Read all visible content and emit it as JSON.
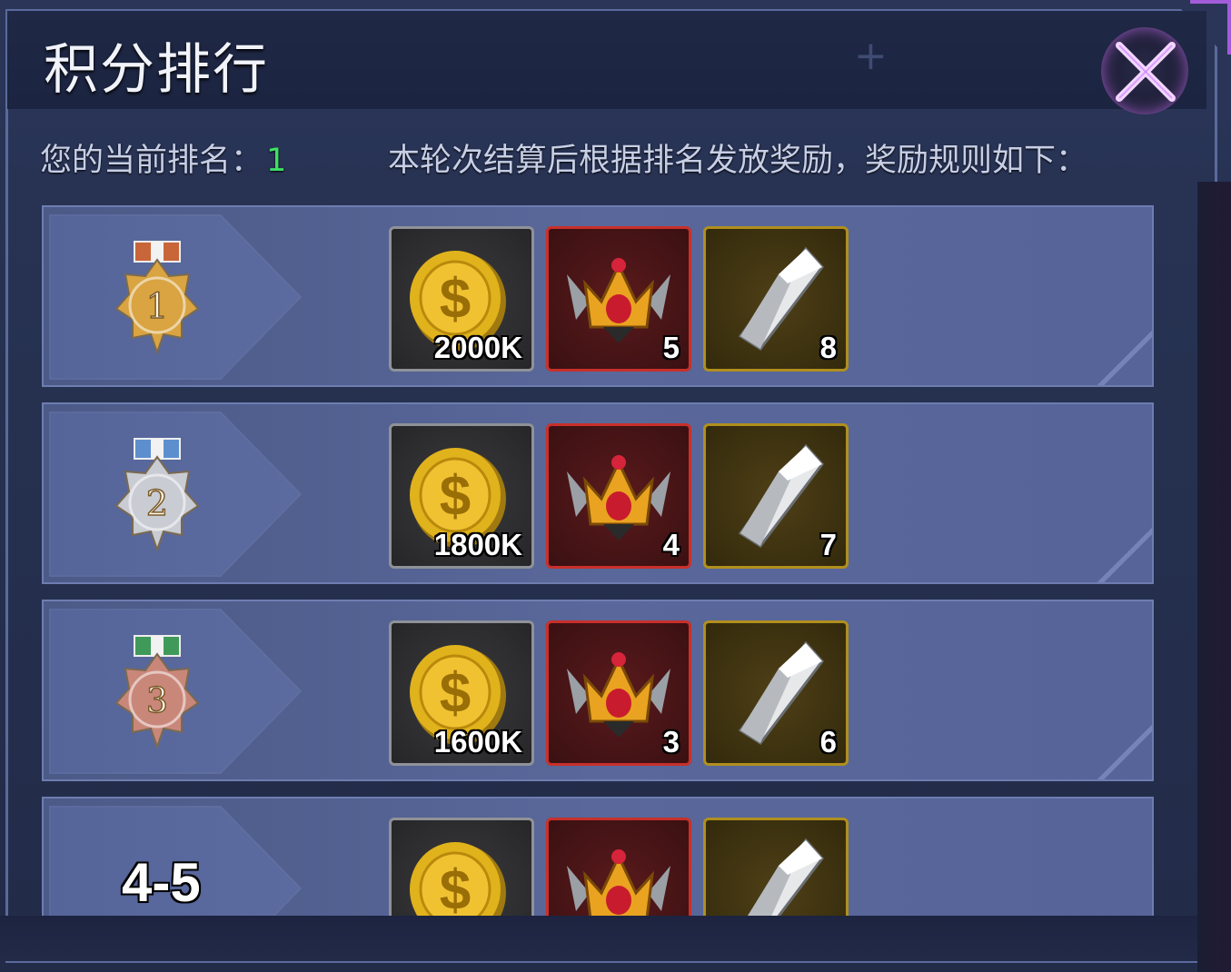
{
  "title": "积分排行",
  "rank_label": "您的当前排名：",
  "rank_value": "1",
  "rule_text": "本轮次结算后根据排名发放奖励，奖励规则如下：",
  "close_icon": "close-x-icon",
  "colors": {
    "rank_value": "#3ee065",
    "medal_gold": "#d9a441",
    "medal_silver": "#c9ccd3",
    "medal_bronze": "#c9877a",
    "coin": "#e0b21c",
    "crown_frame": "#c8302a",
    "crystal_frame": "#b08f1e"
  },
  "rows": [
    {
      "rank": "1",
      "medal": "gold-medal-icon",
      "rewards": [
        {
          "icon": "gold-coin-icon",
          "qty": "2000K"
        },
        {
          "icon": "crown-icon",
          "qty": "5"
        },
        {
          "icon": "crystal-icon",
          "qty": "8"
        }
      ]
    },
    {
      "rank": "2",
      "medal": "silver-medal-icon",
      "rewards": [
        {
          "icon": "gold-coin-icon",
          "qty": "1800K"
        },
        {
          "icon": "crown-icon",
          "qty": "4"
        },
        {
          "icon": "crystal-icon",
          "qty": "7"
        }
      ]
    },
    {
      "rank": "3",
      "medal": "bronze-medal-icon",
      "rewards": [
        {
          "icon": "gold-coin-icon",
          "qty": "1600K"
        },
        {
          "icon": "crown-icon",
          "qty": "3"
        },
        {
          "icon": "crystal-icon",
          "qty": "6"
        }
      ]
    },
    {
      "rank": "4-5",
      "medal": "",
      "rewards": [
        {
          "icon": "gold-coin-icon",
          "qty": ""
        },
        {
          "icon": "crown-icon",
          "qty": ""
        },
        {
          "icon": "crystal-icon",
          "qty": ""
        }
      ]
    }
  ]
}
